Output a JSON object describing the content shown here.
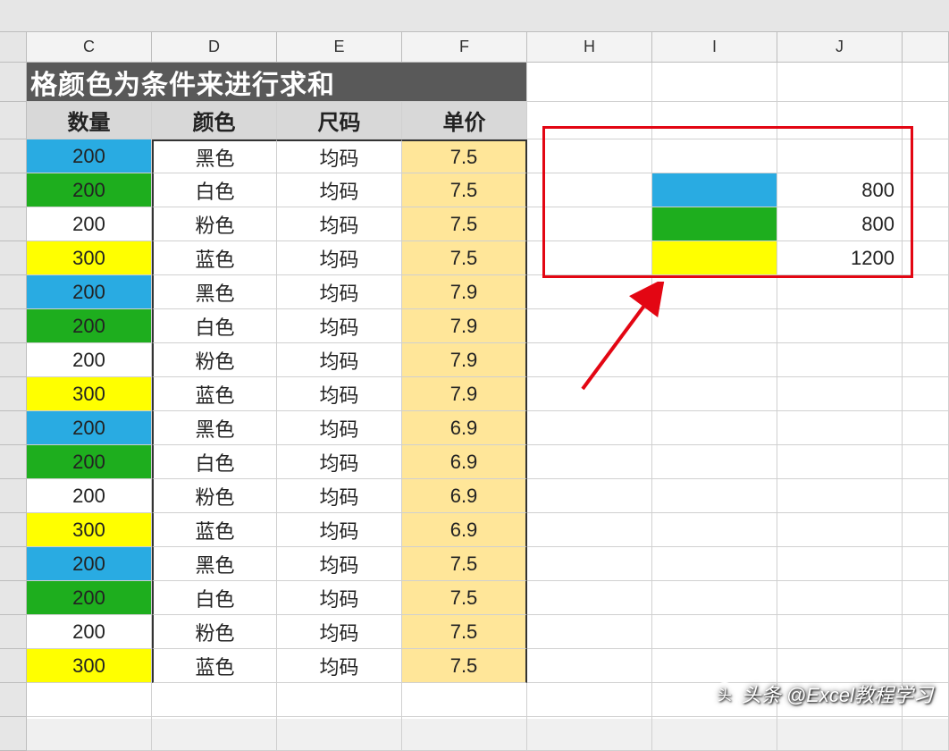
{
  "columns": [
    "C",
    "D",
    "E",
    "F",
    "H",
    "I",
    "J"
  ],
  "title": "格颜色为条件来进行求和",
  "headers": {
    "c": "数量",
    "d": "颜色",
    "e": "尺码",
    "f": "单价"
  },
  "rows": [
    {
      "qty": "200",
      "color": "黑色",
      "size": "均码",
      "price": "7.5",
      "fill": "blue"
    },
    {
      "qty": "200",
      "color": "白色",
      "size": "均码",
      "price": "7.5",
      "fill": "green"
    },
    {
      "qty": "200",
      "color": "粉色",
      "size": "均码",
      "price": "7.5",
      "fill": "white"
    },
    {
      "qty": "300",
      "color": "蓝色",
      "size": "均码",
      "price": "7.5",
      "fill": "yellow"
    },
    {
      "qty": "200",
      "color": "黑色",
      "size": "均码",
      "price": "7.9",
      "fill": "blue"
    },
    {
      "qty": "200",
      "color": "白色",
      "size": "均码",
      "price": "7.9",
      "fill": "green"
    },
    {
      "qty": "200",
      "color": "粉色",
      "size": "均码",
      "price": "7.9",
      "fill": "white"
    },
    {
      "qty": "300",
      "color": "蓝色",
      "size": "均码",
      "price": "7.9",
      "fill": "yellow"
    },
    {
      "qty": "200",
      "color": "黑色",
      "size": "均码",
      "price": "6.9",
      "fill": "blue"
    },
    {
      "qty": "200",
      "color": "白色",
      "size": "均码",
      "price": "6.9",
      "fill": "green"
    },
    {
      "qty": "200",
      "color": "粉色",
      "size": "均码",
      "price": "6.9",
      "fill": "white"
    },
    {
      "qty": "300",
      "color": "蓝色",
      "size": "均码",
      "price": "6.9",
      "fill": "yellow"
    },
    {
      "qty": "200",
      "color": "黑色",
      "size": "均码",
      "price": "7.5",
      "fill": "blue"
    },
    {
      "qty": "200",
      "color": "白色",
      "size": "均码",
      "price": "7.5",
      "fill": "green"
    },
    {
      "qty": "200",
      "color": "粉色",
      "size": "均码",
      "price": "7.5",
      "fill": "white"
    },
    {
      "qty": "300",
      "color": "蓝色",
      "size": "均码",
      "price": "7.5",
      "fill": "yellow"
    }
  ],
  "summary": [
    {
      "fill": "blue",
      "value": "800"
    },
    {
      "fill": "green",
      "value": "800"
    },
    {
      "fill": "yellow",
      "value": "1200"
    }
  ],
  "watermark": "头条 @Excel教程学习"
}
